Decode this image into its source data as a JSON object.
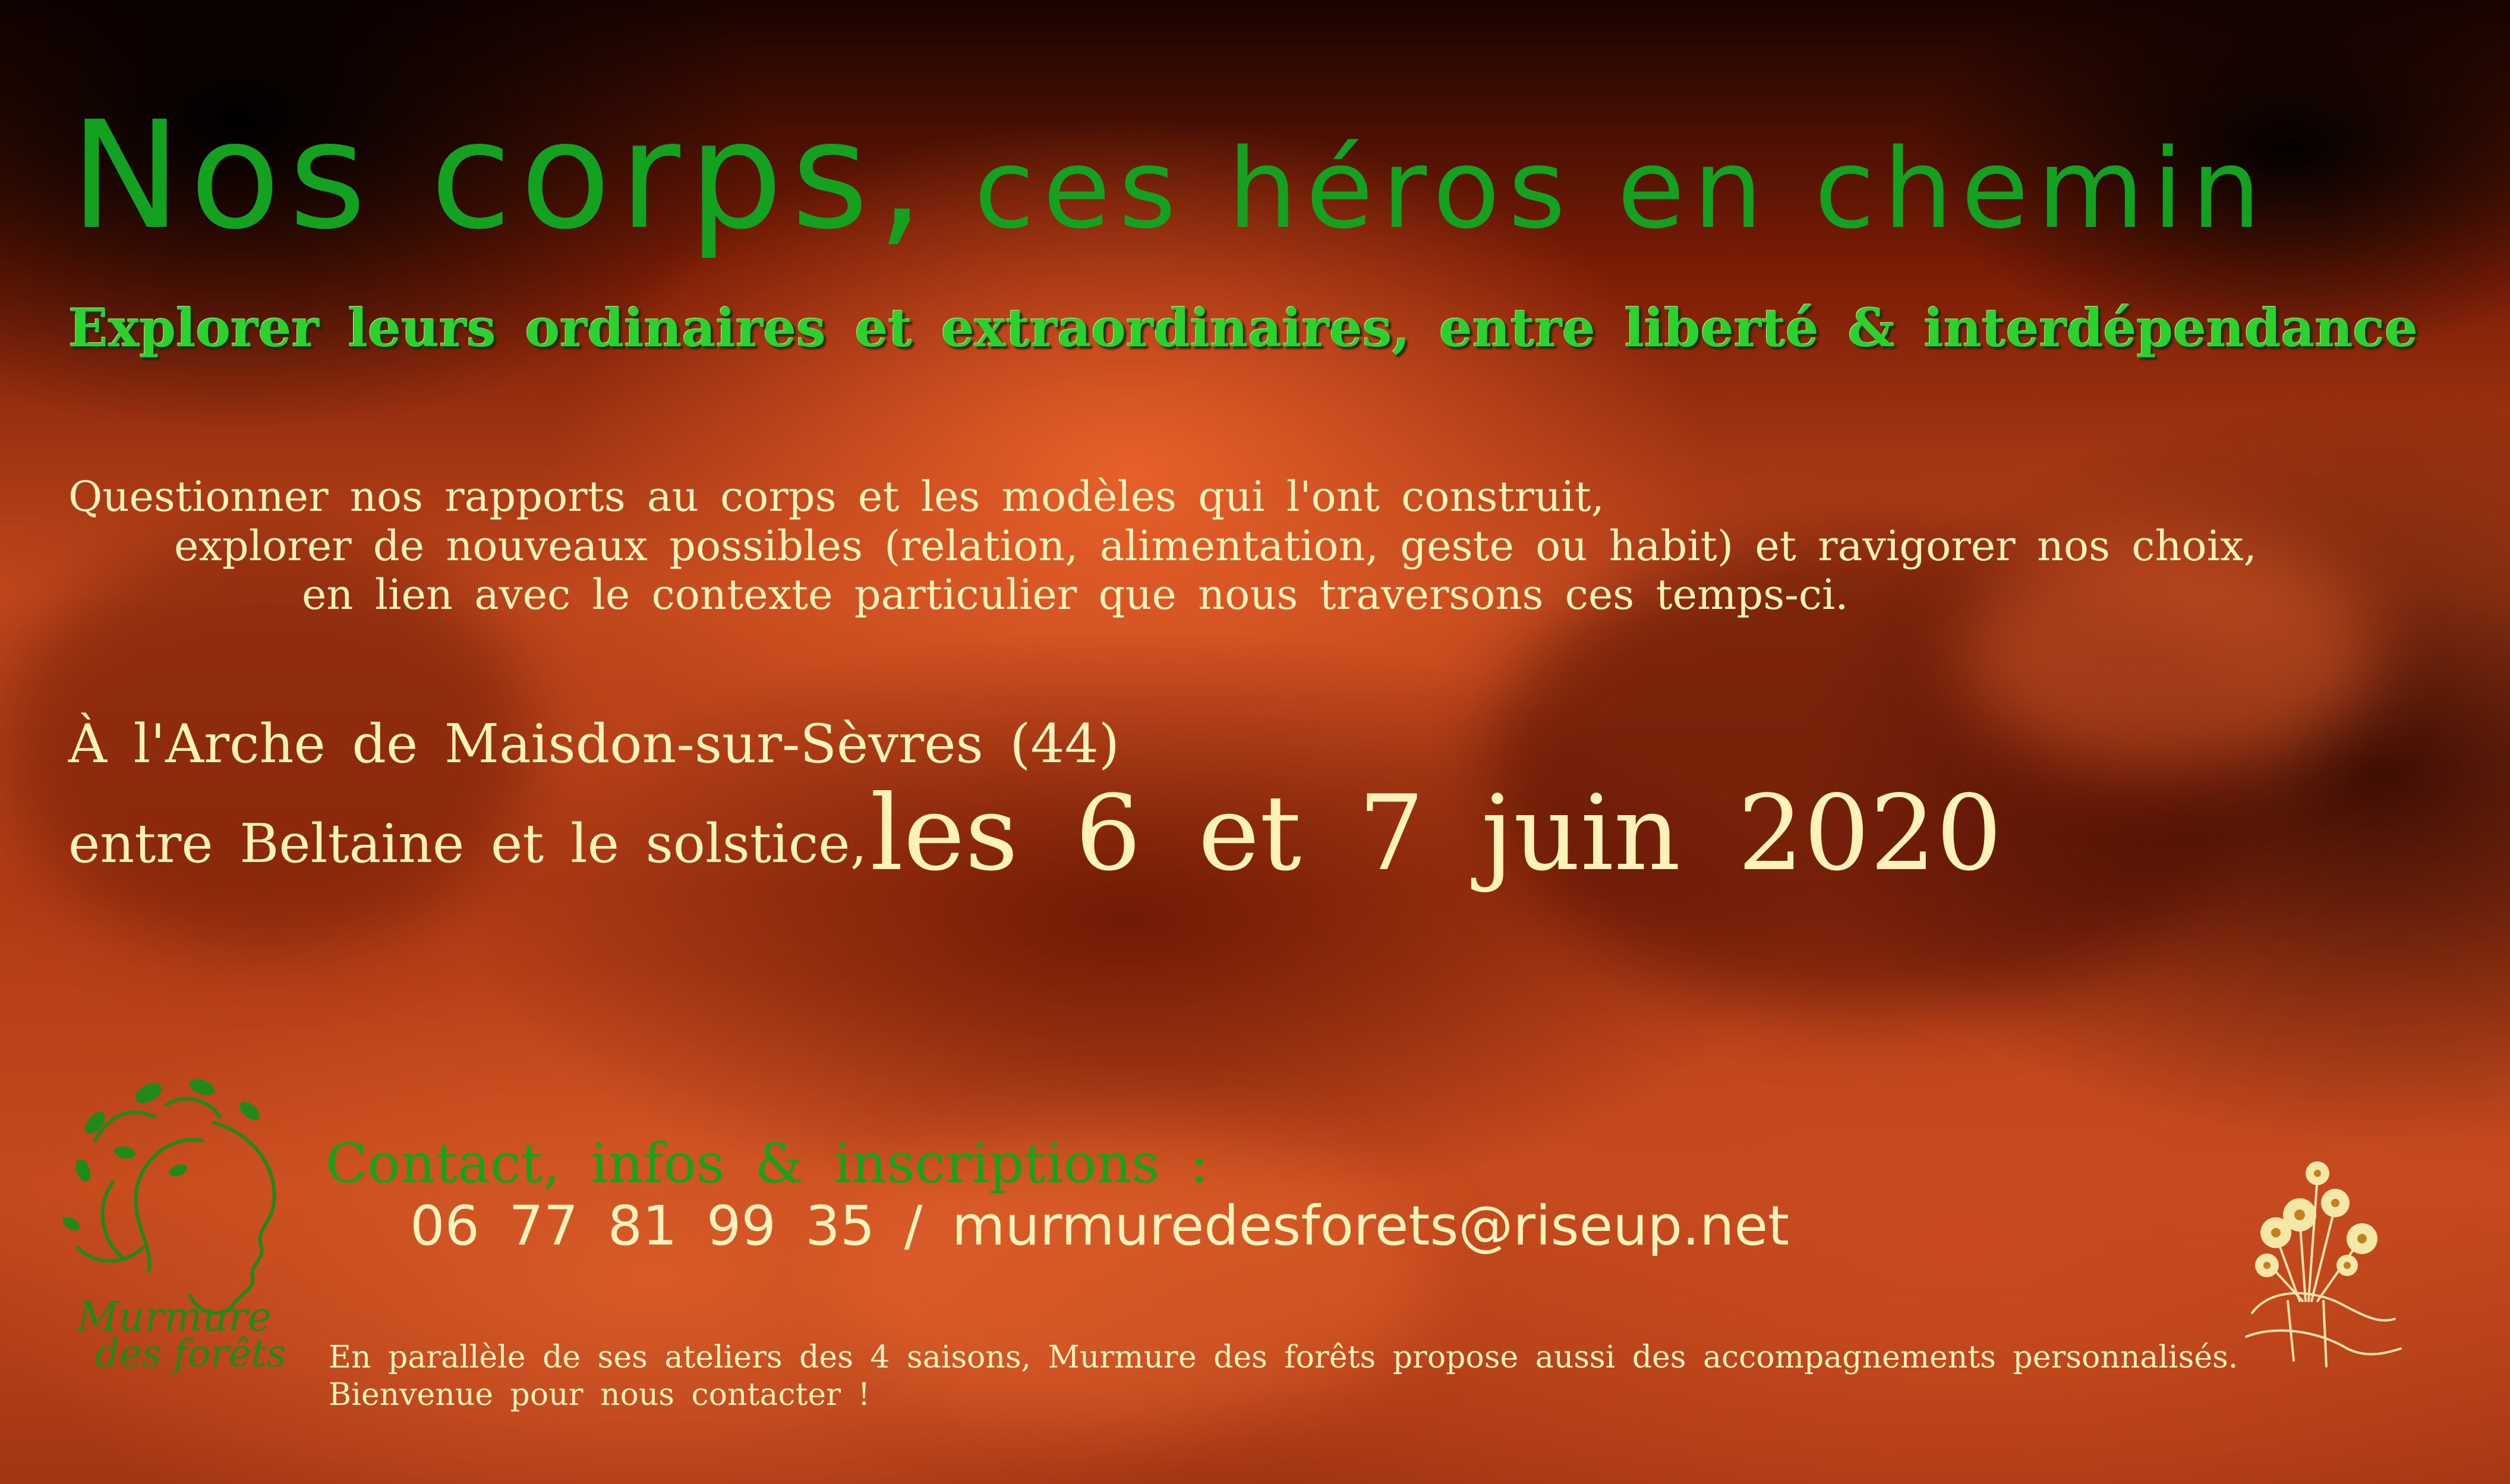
{
  "title": {
    "part1": "Nos corps,",
    "part2": "ces héros en chemin"
  },
  "subtitle": "Explorer leurs ordinaires et extraordinaires, entre liberté & interdépendance",
  "intro": {
    "line1": "Questionner nos rapports au corps et les modèles qui l'ont construit,",
    "line2": "explorer de nouveaux possibles (relation, alimentation, geste ou habit) et ravigorer nos choix,",
    "line3": "en lien avec le contexte particulier que nous traversons ces temps-ci."
  },
  "location": {
    "place": "À l'Arche de Maisdon-sur-Sèvres (44)",
    "when_prefix": "entre Beltaine et le solstice,",
    "date": "les 6 et 7 juin 2020"
  },
  "contact": {
    "heading": "Contact, infos & inscriptions :",
    "phone": "06 77 81 99 35",
    "separator": "/",
    "email": "murmuredesforets@riseup.net"
  },
  "footer": {
    "line1": "En parallèle de ses ateliers des 4 saisons, Murmure des forêts propose aussi des accompagnements personnalisés.",
    "line2": "Bienvenue pour nous contacter !"
  },
  "logo": {
    "line1": "Murmure",
    "line2": "des forêts"
  },
  "colors": {
    "title_green": "#13a11f",
    "subtitle_green": "#2bd12d",
    "cream": "#fff2b8",
    "skin_orange": "#c0481c"
  },
  "icons": {
    "left_logo": "leafy-face-logo-icon",
    "right_logo": "flower-bouquet-hands-icon"
  }
}
